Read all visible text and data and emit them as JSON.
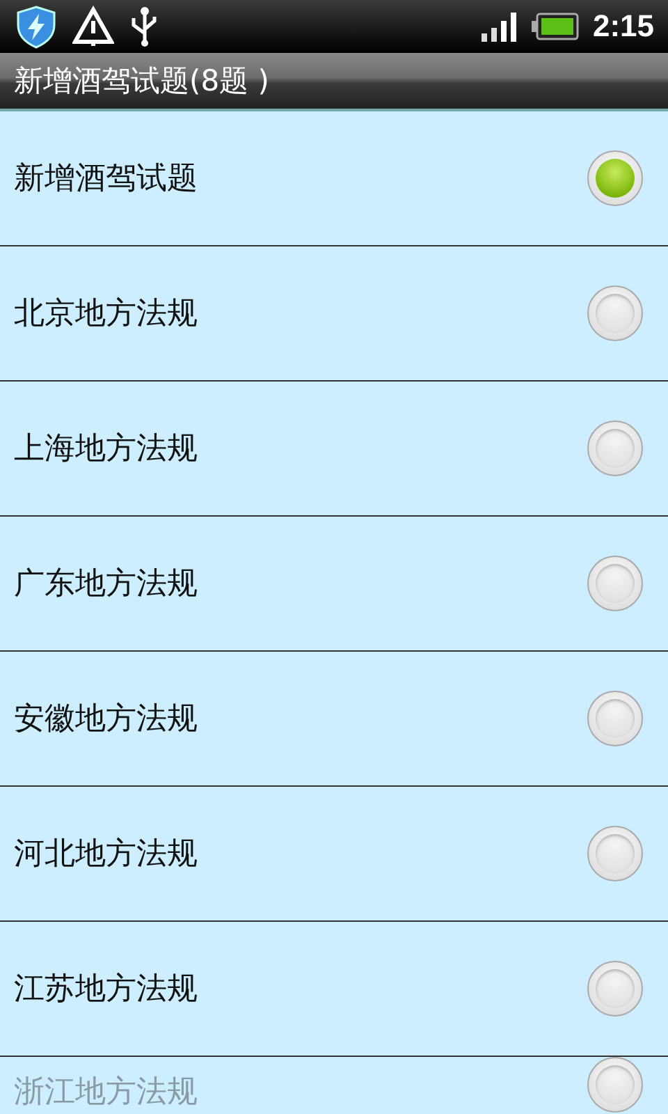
{
  "status_bar": {
    "time": "2:15"
  },
  "title": "新增酒驾试题(8题 )",
  "options": [
    {
      "label": "新增酒驾试题",
      "selected": true
    },
    {
      "label": "北京地方法规",
      "selected": false
    },
    {
      "label": "上海地方法规",
      "selected": false
    },
    {
      "label": "广东地方法规",
      "selected": false
    },
    {
      "label": "安徽地方法规",
      "selected": false
    },
    {
      "label": "河北地方法规",
      "selected": false
    },
    {
      "label": "江苏地方法规",
      "selected": false
    },
    {
      "label": "浙江地方法规",
      "selected": false
    }
  ]
}
